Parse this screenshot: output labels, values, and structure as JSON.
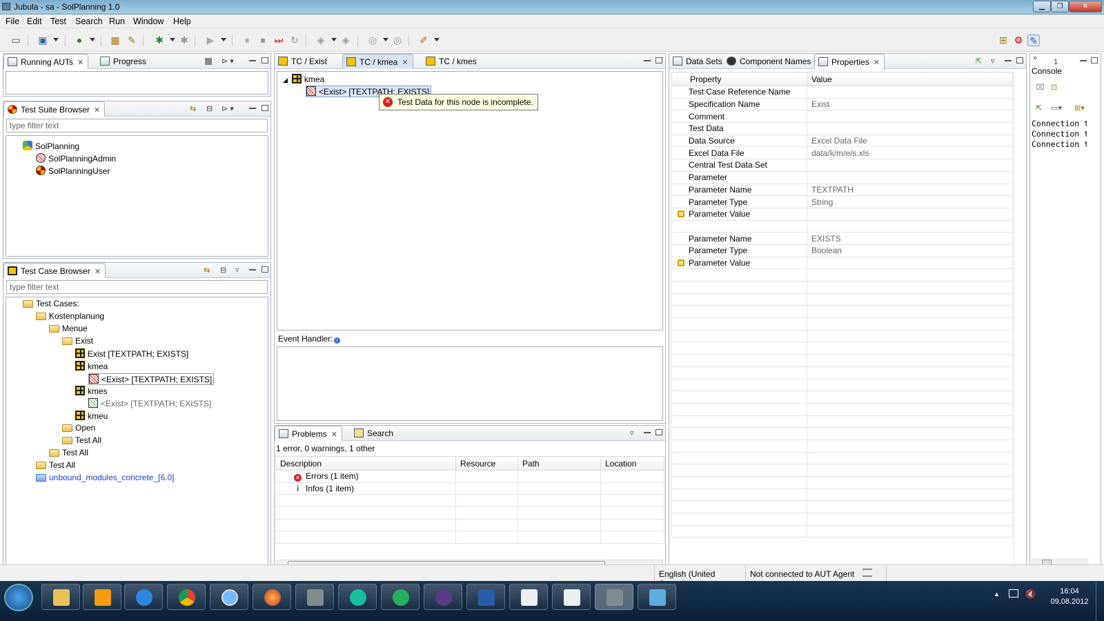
{
  "window": {
    "title": "Jubula - sa - SolPlanning 1.0"
  },
  "menu": [
    "File",
    "Edit",
    "Test",
    "Search",
    "Run",
    "Window",
    "Help"
  ],
  "running": {
    "tabs": [
      "Running AUTs",
      "Progress"
    ]
  },
  "suite_browser": {
    "title": "Test Suite Browser",
    "filter_placeholder": "type filter text",
    "nodes": [
      {
        "label": "SolPlanning"
      },
      {
        "label": "SolPlanningAdmin"
      },
      {
        "label": "SolPlanningUser"
      }
    ]
  },
  "case_browser": {
    "title": "Test Case Browser",
    "filter_placeholder": "type filter text",
    "nodes": [
      "Test Cases:",
      "Kostenplanung",
      "Menue",
      "Exist",
      "Exist [TEXTPATH; EXISTS]",
      "kmea",
      "<Exist> [TEXTPATH; EXISTS]",
      "kmes",
      "<Exist> [TEXTPATH; EXISTS]",
      "kmeu",
      "Open",
      "Test All",
      "Test All",
      "Test All",
      "unbound_modules_concrete_[6.0]"
    ]
  },
  "editor": {
    "tabs": [
      "TC / Exist",
      "TC / kmea",
      "TC / kmes"
    ],
    "root": "kmea",
    "child": "<Exist> [TEXTPATH: EXISTS]",
    "tooltip": "Test Data for this node is incomplete.",
    "event_handler_label": "Event Handler:"
  },
  "problems": {
    "tabs": [
      "Problems",
      "Search"
    ],
    "summary": "1 error, 0 warnings, 1 other",
    "columns": [
      "Description",
      "Resource",
      "Path",
      "Location"
    ],
    "rows": [
      "Errors (1 item)",
      "Infos (1 item)"
    ]
  },
  "properties": {
    "tabs": [
      "Data Sets",
      "Component Names",
      "Properties"
    ],
    "columns": [
      "Property",
      "Value"
    ],
    "rows": [
      [
        "Test Case Reference Name",
        ""
      ],
      [
        "Specification Name",
        "Exist"
      ],
      [
        "Comment",
        ""
      ],
      [
        "Test Data",
        ""
      ],
      [
        "Data Source",
        "Excel Data File"
      ],
      [
        "Excel Data File",
        "data/k/m/e/s.xls"
      ],
      [
        "Central Test Data Set",
        ""
      ],
      [
        "Parameter",
        ""
      ],
      [
        "Parameter Name",
        "TEXTPATH"
      ],
      [
        "Parameter Type",
        "String"
      ],
      [
        "Parameter Value",
        ""
      ],
      [
        "",
        ""
      ],
      [
        "Parameter Name",
        "EXISTS"
      ],
      [
        "Parameter Type",
        "Boolean"
      ],
      [
        "Parameter Value",
        ""
      ]
    ]
  },
  "console": {
    "title": "Console",
    "tab_count": "1",
    "lines": [
      "Connection t",
      "Connection t",
      "Connection t"
    ]
  },
  "status": {
    "locale": "English (United States)",
    "connection": "Not connected to AUT Agent"
  },
  "taskbar": {
    "time": "16:04",
    "date": "09.08.2012"
  }
}
